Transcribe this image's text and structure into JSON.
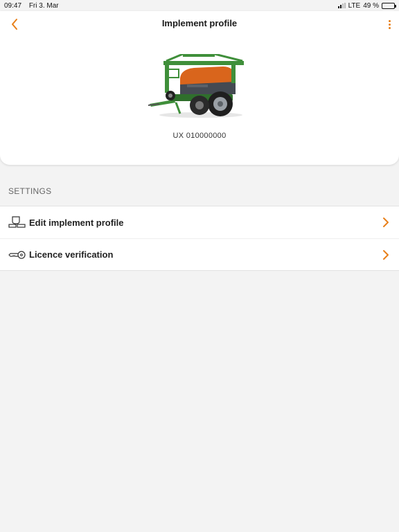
{
  "status_bar": {
    "time": "09:47",
    "date": "Fri 3. Mar",
    "network": "LTE",
    "battery": "49 %",
    "battery_level": 0.49
  },
  "header": {
    "title": "Implement profile",
    "back_icon": "chevron-left-icon",
    "menu_icon": "more-vertical-icon"
  },
  "implement": {
    "id": "UX 010000000",
    "image": "field-sprayer-image"
  },
  "settings": {
    "section_label": "SETTINGS",
    "items": [
      {
        "label": "Edit implement profile",
        "icon": "implement-edit-icon"
      },
      {
        "label": "Licence verification",
        "icon": "key-icon"
      }
    ]
  },
  "colors": {
    "accent": "#e8801a",
    "background": "#f3f3f3",
    "card": "#ffffff",
    "implement_green": "#3f8f3a",
    "implement_orange": "#d9651c"
  }
}
